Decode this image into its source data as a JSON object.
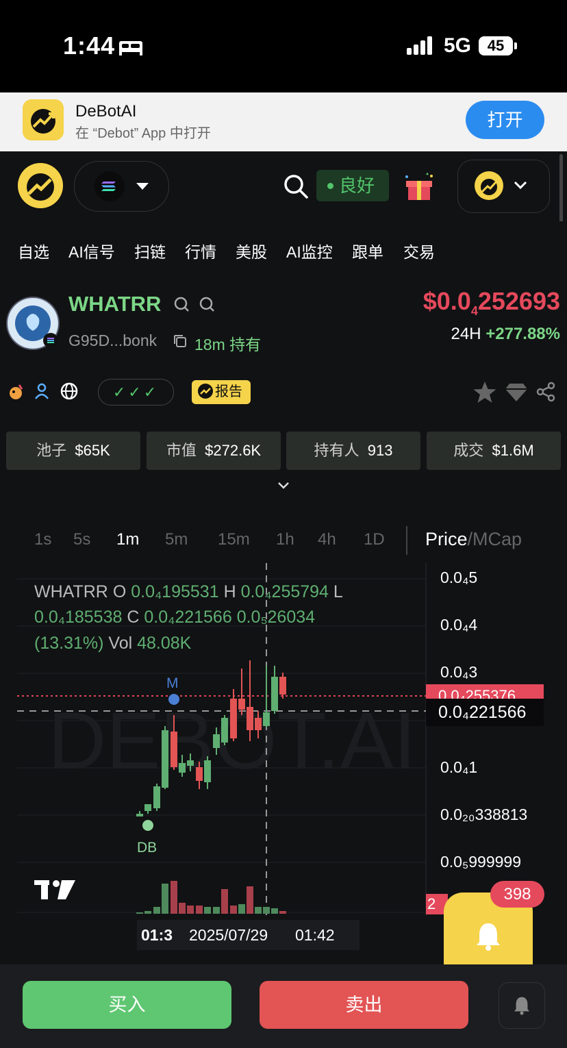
{
  "status_bar": {
    "time": "1:44",
    "network": "5G",
    "battery": "45"
  },
  "banner": {
    "app_name": "DeBotAI",
    "subtitle": "在 “Debot” App 中打开",
    "open_button": "打开"
  },
  "header": {
    "status_badge": "良好"
  },
  "nav": [
    "自选",
    "AI信号",
    "扫链",
    "行情",
    "美股",
    "AI监控",
    "跟单",
    "交易"
  ],
  "token": {
    "symbol": "WHATRR",
    "address": "G95D...bonk",
    "hold_time": "18m 持有",
    "price_main": "$0.0",
    "price_sub": "4",
    "price_tail": "252693",
    "change_label": "24H",
    "change_value": "+277.88%"
  },
  "checks": "✓✓✓",
  "report_label": "报告",
  "stats": [
    {
      "label": "池子",
      "value": "$65K"
    },
    {
      "label": "市值",
      "value": "$272.6K"
    },
    {
      "label": "持有人",
      "value": "913"
    },
    {
      "label": "成交",
      "value": "$1.6M"
    }
  ],
  "timeframes": [
    "1s",
    "5s",
    "1m",
    "5m",
    "15m",
    "1h",
    "4h",
    "1D"
  ],
  "active_timeframe": "1m",
  "price_mcap": {
    "price": "Price",
    "sep": "/",
    "mcap": "MCap"
  },
  "chart": {
    "watermark": "DEBOT.AI",
    "ohlc_line1": {
      "name": "WHATRR",
      "o_lbl": "O",
      "o": "0.0₄195531",
      "h_lbl": "H",
      "h": "0.0₄255794",
      "l_lbl": "L"
    },
    "ohlc_line2": {
      "l": "0.0₄185538",
      "c_lbl": "C",
      "c": "0.0₄221566",
      "chg": "0.0₅26034"
    },
    "ohlc_line3": {
      "pct": "(13.31%)",
      "vol_lbl": "Vol",
      "vol": "48.08K"
    },
    "y_labels": [
      "0.0₄5",
      "0.0₄4",
      "0.0₄3",
      "0.0₄1",
      "0.0₂₀338813",
      "0.0₅999999"
    ],
    "current_price_tag": "0.0₄255376",
    "crosshair_price_tag": "0.0₄221566",
    "marker_m": "M",
    "marker_db": "DB",
    "time_left": "01:3",
    "time_date": "2025/07/29",
    "time_clock": "01:42",
    "bottom_tag": "2",
    "alert_count": "398"
  },
  "chart_data": {
    "type": "candlestick",
    "series": [
      {
        "name": "WHATRR"
      }
    ],
    "y_tick_labels": [
      "0.0₄5",
      "0.0₄4",
      "0.0₄3",
      "0.0₄1",
      "0.0₂₀338813",
      "0.0₅999999"
    ],
    "last_candle": {
      "open": "0.0₄195531",
      "high": "0.0₄255794",
      "low": "0.0₄185538",
      "close": "0.0₄221566",
      "change": "0.0₅26034",
      "change_pct": "13.31%",
      "volume": "48.08K"
    }
  },
  "actions": {
    "buy": "买入",
    "sell": "卖出"
  },
  "colors": {
    "up": "#5faf72",
    "down": "#e35454",
    "accent": "#f5d34a",
    "link": "#2b8cf0"
  }
}
